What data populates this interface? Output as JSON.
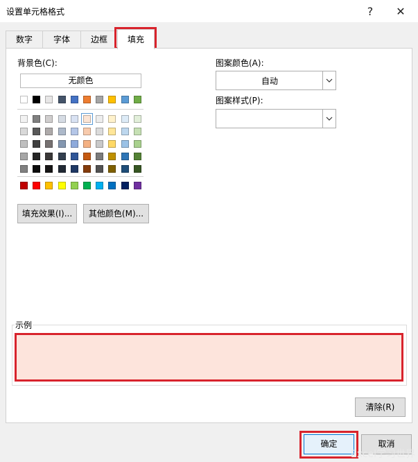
{
  "window": {
    "title": "设置单元格格式",
    "help_label": "?",
    "close_label": "✕"
  },
  "tabs": [
    {
      "label": "数字"
    },
    {
      "label": "字体"
    },
    {
      "label": "边框"
    },
    {
      "label": "填充"
    }
  ],
  "active_tab": "填充",
  "fill": {
    "background_label": "背景色(C):",
    "no_color_label": "无颜色",
    "fill_effects_label": "填充效果(I)...",
    "more_colors_label": "其他颜色(M)...",
    "pattern_color_label": "图案颜色(A):",
    "pattern_color_value": "自动",
    "pattern_style_label": "图案样式(P):",
    "pattern_style_value": ""
  },
  "palette": {
    "theme_top": [
      "#ffffff",
      "#000000",
      "#e7e6e6",
      "#44546a",
      "#4472c4",
      "#ed7d31",
      "#a5a5a5",
      "#ffc000",
      "#5b9bd5",
      "#70ad47"
    ],
    "theme_rows": [
      [
        "#f2f2f2",
        "#808080",
        "#d0cece",
        "#d6dce4",
        "#d9e2f3",
        "#fbe5d6",
        "#ededed",
        "#fff2cc",
        "#ddebf7",
        "#e2efda"
      ],
      [
        "#d9d9d9",
        "#595959",
        "#aeaaaa",
        "#adb9ca",
        "#b4c6e7",
        "#f8cbad",
        "#dbdbdb",
        "#ffe699",
        "#bdd7ee",
        "#c6e0b4"
      ],
      [
        "#bfbfbf",
        "#404040",
        "#767171",
        "#8497b0",
        "#8eaadb",
        "#f4b183",
        "#c9c9c9",
        "#ffd966",
        "#9bc2e6",
        "#a9d18e"
      ],
      [
        "#a6a6a6",
        "#262626",
        "#3a3838",
        "#333f4f",
        "#2f5597",
        "#c55a11",
        "#7b7b7b",
        "#bf9000",
        "#2e75b6",
        "#548235"
      ],
      [
        "#808080",
        "#0d0d0d",
        "#171616",
        "#222a35",
        "#1f3864",
        "#843c0c",
        "#525252",
        "#7f6000",
        "#1f4e78",
        "#375623"
      ]
    ],
    "standard": [
      "#c00000",
      "#ff0000",
      "#ffc000",
      "#ffff00",
      "#92d050",
      "#00b050",
      "#00b0f0",
      "#0070c0",
      "#002060",
      "#7030a0"
    ],
    "selected": "#fbe5d6"
  },
  "sample": {
    "label": "示例",
    "color": "#fde4dc"
  },
  "clear_label": "清除(R)",
  "ok_label": "确定",
  "cancel_label": "取消",
  "highlight_color": "#d8232c",
  "watermark": "Excel学习世界"
}
